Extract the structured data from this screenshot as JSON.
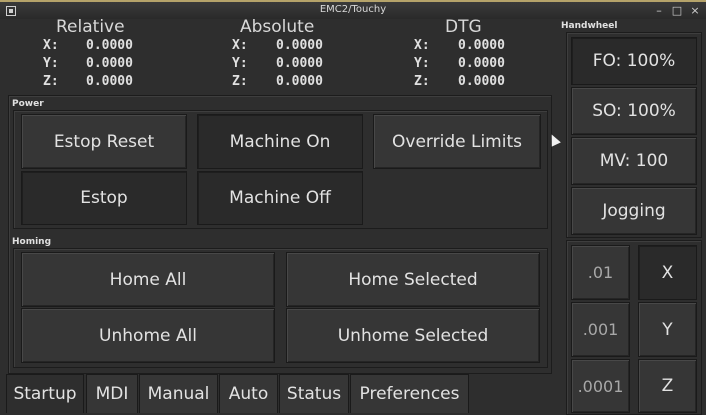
{
  "window": {
    "title": "EMC2/Touchy"
  },
  "dro": {
    "relative": {
      "label": "Relative",
      "rows": [
        {
          "axis": "X:",
          "value": "0.0000"
        },
        {
          "axis": "Y:",
          "value": "0.0000"
        },
        {
          "axis": "Z:",
          "value": "0.0000"
        }
      ]
    },
    "absolute": {
      "label": "Absolute",
      "rows": [
        {
          "axis": "X:",
          "value": "0.0000"
        },
        {
          "axis": "Y:",
          "value": "0.0000"
        },
        {
          "axis": "Z:",
          "value": "0.0000"
        }
      ]
    },
    "dtg": {
      "label": "DTG",
      "rows": [
        {
          "axis": "X:",
          "value": "0.0000"
        },
        {
          "axis": "Y:",
          "value": "0.0000"
        },
        {
          "axis": "Z:",
          "value": "0.0000"
        }
      ]
    }
  },
  "power": {
    "label": "Power",
    "estop_reset": "Estop Reset",
    "machine_on": "Machine On",
    "override_limits": "Override Limits",
    "estop": "Estop",
    "machine_off": "Machine Off"
  },
  "homing": {
    "label": "Homing",
    "home_all": "Home All",
    "home_selected": "Home Selected",
    "unhome_all": "Unhome All",
    "unhome_selected": "Unhome Selected"
  },
  "tabs": [
    "Startup",
    "MDI",
    "Manual",
    "Auto",
    "Status",
    "Preferences"
  ],
  "handwheel": {
    "label": "Handwheel",
    "fo": "FO: 100%",
    "so": "SO: 100%",
    "mv": "MV: 100",
    "jogging": "Jogging",
    "increments": [
      ".01",
      ".001",
      ".0001"
    ],
    "axes": [
      "X",
      "Y",
      "Z"
    ]
  }
}
